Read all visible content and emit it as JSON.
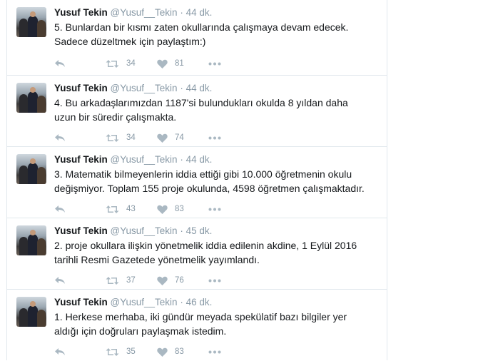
{
  "colors": {
    "text": "#14171a",
    "muted": "#8899a6",
    "border": "#e1e8ed"
  },
  "tweets": [
    {
      "name": "Yusuf Tekin",
      "handle": "@Yusuf__Tekin",
      "dot": "·",
      "time": "44 dk.",
      "text_line1": "5. Bunlardan bir kısmı zaten okullarında çalışmaya devam edecek.",
      "text_line2": "Sadece düzeltmek için paylaştım:)",
      "retweets": "34",
      "likes": "81"
    },
    {
      "name": "Yusuf Tekin",
      "handle": "@Yusuf__Tekin",
      "dot": "·",
      "time": "44 dk.",
      "text_line1": "4. Bu arkadaşlarımızdan 1187'si bulundukları okulda 8 yıldan daha",
      "text_line2": "uzun bir süredir çalışmakta.",
      "retweets": "34",
      "likes": "74"
    },
    {
      "name": "Yusuf Tekin",
      "handle": "@Yusuf__Tekin",
      "dot": "·",
      "time": "44 dk.",
      "text_line1": "3. Matematik bilmeyenlerin iddia ettiği gibi 10.000 öğretmenin okulu",
      "text_line2": "değişmiyor. Toplam 155 proje okulunda, 4598 öğretmen çalışmaktadır.",
      "retweets": "43",
      "likes": "83"
    },
    {
      "name": "Yusuf Tekin",
      "handle": "@Yusuf__Tekin",
      "dot": "·",
      "time": "45 dk.",
      "text_line1": "2. proje okullara ilişkin yönetmelik iddia edilenin akdine, 1 Eylül 2016",
      "text_line2": "tarihli Resmi Gazetede yönetmelik yayımlandı.",
      "retweets": "37",
      "likes": "76"
    },
    {
      "name": "Yusuf Tekin",
      "handle": "@Yusuf__Tekin",
      "dot": "·",
      "time": "46 dk.",
      "text_line1": "1. Herkese merhaba, iki gündür meyada spekülatif bazı bilgiler yer",
      "text_line2": "aldığı için doğruları paylaşmak istedim.",
      "retweets": "35",
      "likes": "83"
    }
  ],
  "icons": {
    "reply": "reply-icon",
    "retweet": "retweet-icon",
    "like": "heart-icon",
    "more": "more-icon"
  }
}
